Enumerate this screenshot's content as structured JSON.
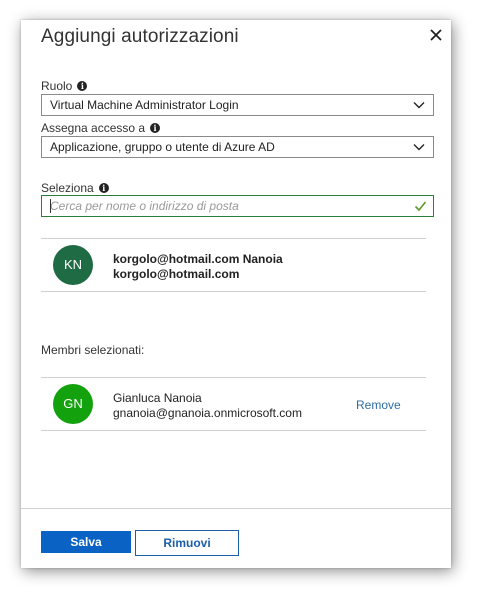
{
  "dialog": {
    "title": "Aggiungi autorizzazioni"
  },
  "role": {
    "label": "Ruolo",
    "value": "Virtual Machine Administrator Login"
  },
  "assign_access": {
    "label": "Assegna accesso a",
    "value": "Applicazione, gruppo o utente di Azure AD"
  },
  "select": {
    "label": "Seleziona",
    "placeholder": "Cerca per nome o indirizzo di posta"
  },
  "search_results": [
    {
      "initials": "KN",
      "avatar_color": "#1e6b44",
      "name": "korgolo@hotmail.com Nanoia",
      "email": "korgolo@hotmail.com"
    }
  ],
  "selected_members": {
    "label": "Membri selezionati:",
    "items": [
      {
        "initials": "GN",
        "avatar_color": "#13a10e",
        "name": "Gianluca Nanoia",
        "email": "gnanoia@gnanoia.onmicrosoft.com",
        "remove_label": "Remove"
      }
    ]
  },
  "footer": {
    "save_label": "Salva",
    "discard_label": "Rimuovi"
  },
  "colors": {
    "primary": "#0a62c4",
    "search_border": "#2d7d3a",
    "link": "#2e6da4"
  }
}
